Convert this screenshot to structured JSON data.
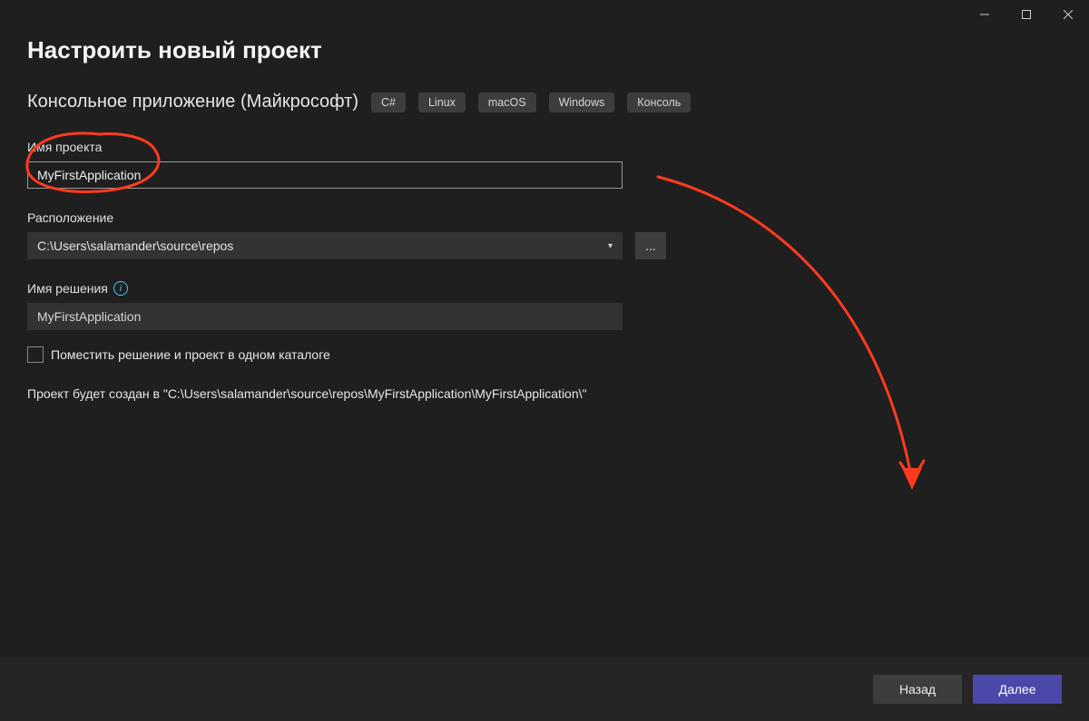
{
  "window": {
    "title": "Настроить новый проект",
    "subtitle": "Консольное приложение (Майкрософт)",
    "tags": [
      "C#",
      "Linux",
      "macOS",
      "Windows",
      "Консоль"
    ]
  },
  "fields": {
    "projectName": {
      "label": "Имя проекта",
      "value": "MyFirstApplication"
    },
    "location": {
      "label": "Расположение",
      "value": "C:\\Users\\salamander\\source\\repos",
      "browse": "..."
    },
    "solutionName": {
      "label": "Имя решения",
      "value": "MyFirstApplication"
    },
    "sameDirCheckbox": {
      "label": "Поместить решение и проект в одном каталоге",
      "checked": false
    }
  },
  "createPathText": "Проект будет создан в \"C:\\Users\\salamander\\source\\repos\\MyFirstApplication\\MyFirstApplication\\\"",
  "buttons": {
    "back": "Назад",
    "next": "Далее"
  },
  "annotationColor": "#ff3b1f"
}
